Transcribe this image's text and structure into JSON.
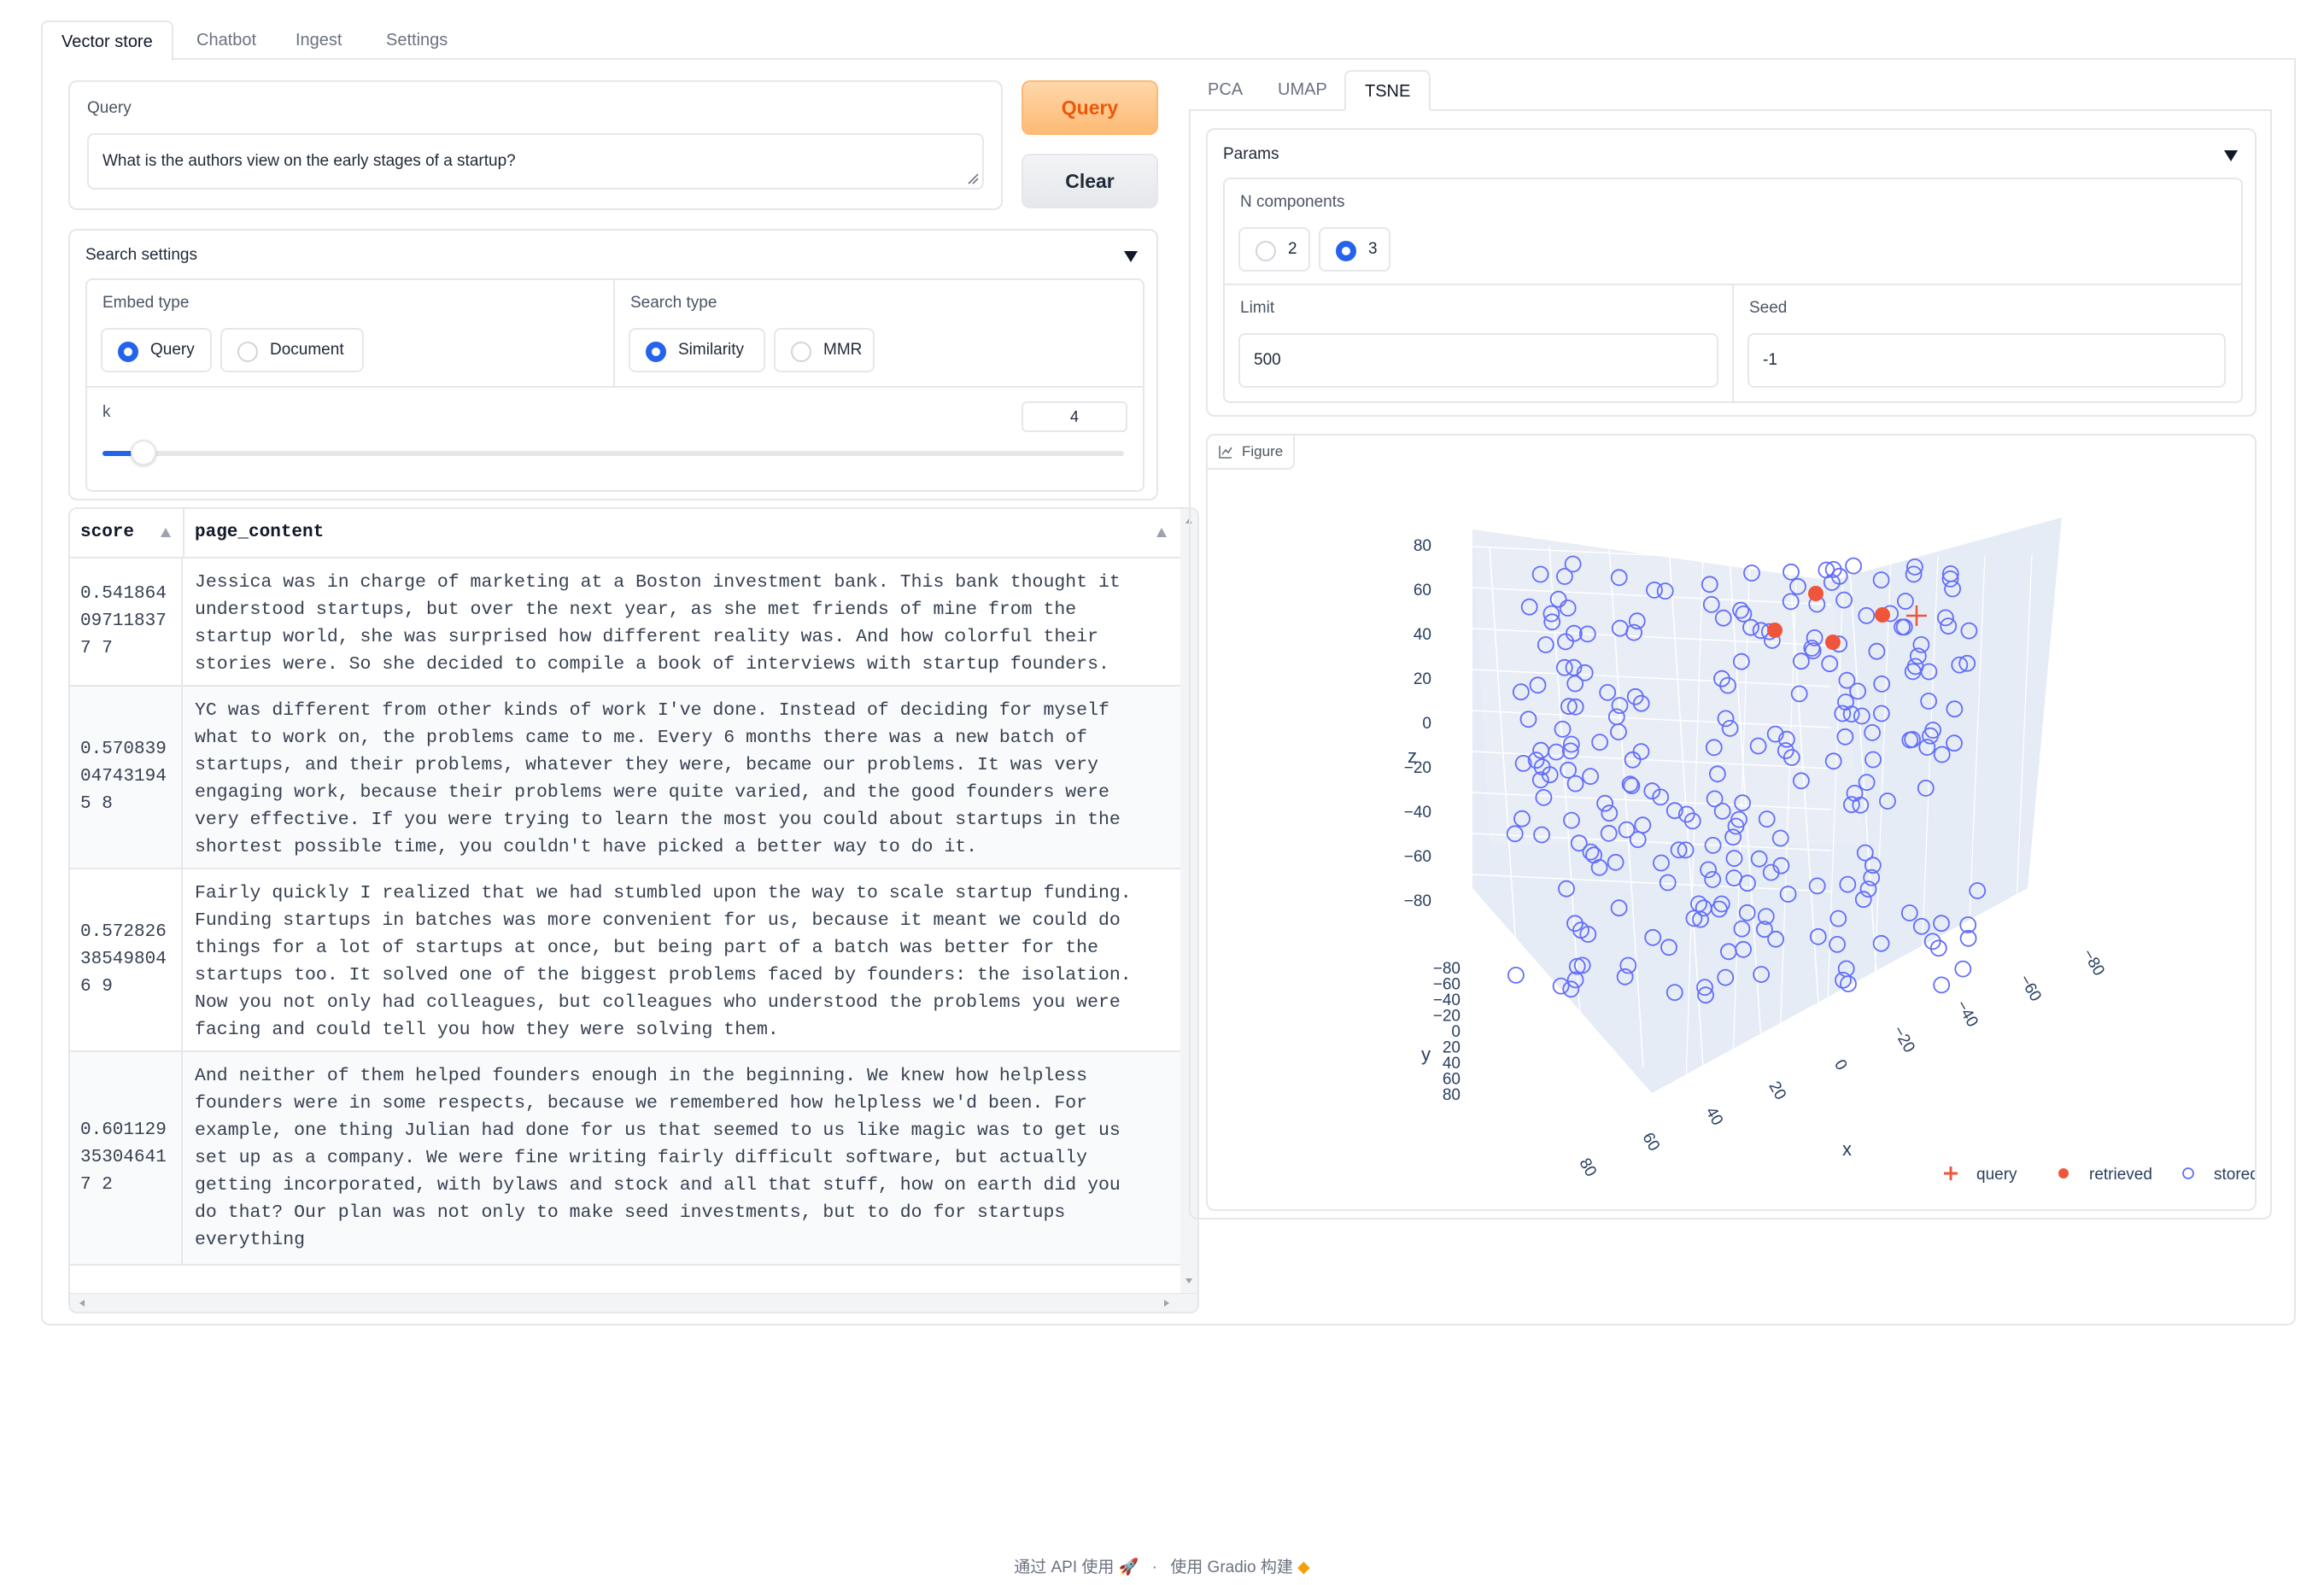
{
  "tabs": [
    "Vector store",
    "Chatbot",
    "Ingest",
    "Settings"
  ],
  "query": {
    "label": "Query",
    "value": "What is the authors view on the early stages of a startup?",
    "query_button": "Query",
    "clear_button": "Clear"
  },
  "search_settings": {
    "title": "Search settings",
    "embed_type": {
      "label": "Embed type",
      "options": [
        "Query",
        "Document"
      ],
      "selected": "Query"
    },
    "search_type": {
      "label": "Search type",
      "options": [
        "Similarity",
        "MMR"
      ],
      "selected": "Similarity"
    },
    "k": {
      "label": "k",
      "value": "4",
      "fraction": 0.04
    }
  },
  "results": {
    "columns": [
      "score",
      "page_content"
    ],
    "rows": [
      {
        "score": "0.541864097118377 7",
        "content": "Jessica was in charge of marketing at a Boston investment bank. This bank thought it\nunderstood startups, but over the next year, as she met friends of mine from the\nstartup world, she was surprised how different reality was. And how colorful their\nstories were. So she decided to compile a book of interviews with startup founders."
      },
      {
        "score": "0.570839047431945 8",
        "content": "YC was different from other kinds of work I've done. Instead of deciding for myself\nwhat to work on, the problems came to me. Every 6 months there was a new batch of\nstartups, and their problems, whatever they were, became our problems. It was very\nengaging work, because their problems were quite varied, and the good founders were\nvery effective. If you were trying to learn the most you could about startups in the\nshortest possible time, you couldn't have picked a better way to do it."
      },
      {
        "score": "0.572826385498046 9",
        "content": "Fairly quickly I realized that we had stumbled upon the way to scale startup funding.\nFunding startups in batches was more convenient for us, because it meant we could do\nthings for a lot of startups at once, but being part of a batch was better for the\nstartups too. It solved one of the biggest problems faced by founders: the isolation.\nNow you not only had colleagues, but colleagues who understood the problems you were\nfacing and could tell you how they were solving them."
      },
      {
        "score": "0.601129353046417 2",
        "content": "And neither of them helped founders enough in the beginning. We knew how helpless\nfounders were in some respects, because we remembered how helpless we'd been. For\nexample, one thing Julian had done for us that seemed to us like magic was to get us\nset up as a company. We were fine writing fairly difficult software, but actually\ngetting incorporated, with bylaws and stock and all that stuff, how on earth did you\ndo that? Our plan was not only to make seed investments, but to do for startups\neverything"
      }
    ]
  },
  "projection": {
    "tabs": [
      "PCA",
      "UMAP",
      "TSNE"
    ],
    "active_tab": "TSNE",
    "params_title": "Params",
    "n_components": {
      "label": "N components",
      "options": [
        "2",
        "3"
      ],
      "selected": "3"
    },
    "limit": {
      "label": "Limit",
      "value": "500"
    },
    "seed": {
      "label": "Seed",
      "value": "-1"
    },
    "figure_label": "Figure"
  },
  "chart_data": {
    "type": "scatter",
    "title": "",
    "xlabel": "x",
    "ylabel": "y",
    "zlabel": "z",
    "z_ticks": [
      "80",
      "60",
      "40",
      "20",
      "0",
      "−20",
      "−40",
      "−60",
      "−80"
    ],
    "y_ticks": [
      "−80",
      "−60",
      "−40",
      "−20",
      "0",
      "20",
      "40",
      "60",
      "80"
    ],
    "x_ticks": [
      "80",
      "60",
      "40",
      "20",
      "0",
      "−20",
      "−40",
      "−60",
      "−80"
    ],
    "legend": {
      "placement": "bottom-right",
      "entries": [
        "query",
        "retrieved",
        "stored"
      ]
    },
    "colors": {
      "query": "#ef553b",
      "retrieved": "#ef553b",
      "stored": "#636efa",
      "scene_bg": "#e5ecf6"
    },
    "series": [
      {
        "name": "query",
        "marker": "cross",
        "points": [
          [
            -35,
            0,
            57
          ]
        ]
      },
      {
        "name": "retrieved",
        "marker": "filled-circle",
        "points": [
          [
            -15,
            -5,
            65
          ],
          [
            -25,
            10,
            55
          ],
          [
            5,
            -5,
            46
          ],
          [
            -5,
            10,
            40
          ]
        ]
      },
      {
        "name": "stored",
        "marker": "open-circle",
        "count": 240
      }
    ]
  },
  "footer": {
    "api": "通过 API 使用",
    "built": "使用 Gradio 构建",
    "sep": "·"
  }
}
